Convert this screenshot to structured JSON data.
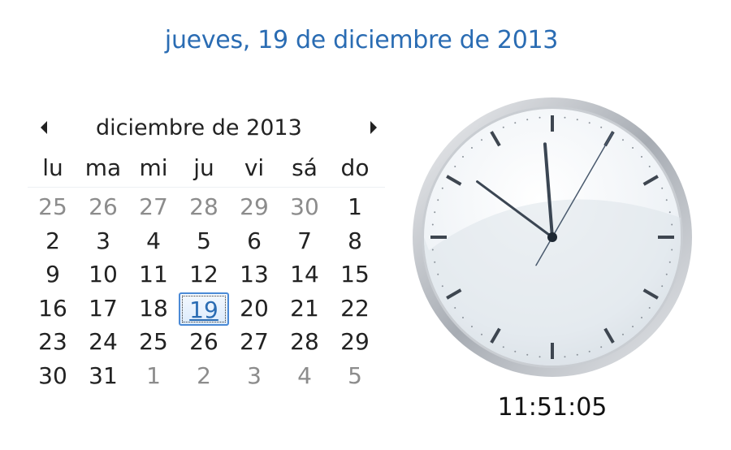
{
  "header": {
    "long_date": "jueves, 19 de diciembre de 2013"
  },
  "calendar": {
    "month_label": "diciembre de 2013",
    "prev_icon": "left-triangle-icon",
    "next_icon": "right-triangle-icon",
    "weekdays": [
      "lu",
      "ma",
      "mi",
      "ju",
      "vi",
      "sá",
      "do"
    ],
    "weeks": [
      [
        {
          "d": "25",
          "o": true
        },
        {
          "d": "26",
          "o": true
        },
        {
          "d": "27",
          "o": true
        },
        {
          "d": "28",
          "o": true
        },
        {
          "d": "29",
          "o": true
        },
        {
          "d": "30",
          "o": true
        },
        {
          "d": "1"
        }
      ],
      [
        {
          "d": "2"
        },
        {
          "d": "3"
        },
        {
          "d": "4"
        },
        {
          "d": "5"
        },
        {
          "d": "6"
        },
        {
          "d": "7"
        },
        {
          "d": "8"
        }
      ],
      [
        {
          "d": "9"
        },
        {
          "d": "10"
        },
        {
          "d": "11"
        },
        {
          "d": "12"
        },
        {
          "d": "13"
        },
        {
          "d": "14"
        },
        {
          "d": "15"
        }
      ],
      [
        {
          "d": "16"
        },
        {
          "d": "17"
        },
        {
          "d": "18"
        },
        {
          "d": "19",
          "today": true
        },
        {
          "d": "20"
        },
        {
          "d": "21"
        },
        {
          "d": "22"
        }
      ],
      [
        {
          "d": "23"
        },
        {
          "d": "24"
        },
        {
          "d": "25"
        },
        {
          "d": "26"
        },
        {
          "d": "27"
        },
        {
          "d": "28"
        },
        {
          "d": "29"
        }
      ],
      [
        {
          "d": "30"
        },
        {
          "d": "31"
        },
        {
          "d": "1",
          "o": true
        },
        {
          "d": "2",
          "o": true
        },
        {
          "d": "3",
          "o": true
        },
        {
          "d": "4",
          "o": true
        },
        {
          "d": "5",
          "o": true
        }
      ]
    ]
  },
  "clock": {
    "digital_time": "11:51:05",
    "hour": 11,
    "minute": 51,
    "second": 5
  },
  "colors": {
    "link_blue": "#2a6cb3",
    "today_border": "#4b8ad6",
    "other_month_gray": "#8c8c8c"
  }
}
